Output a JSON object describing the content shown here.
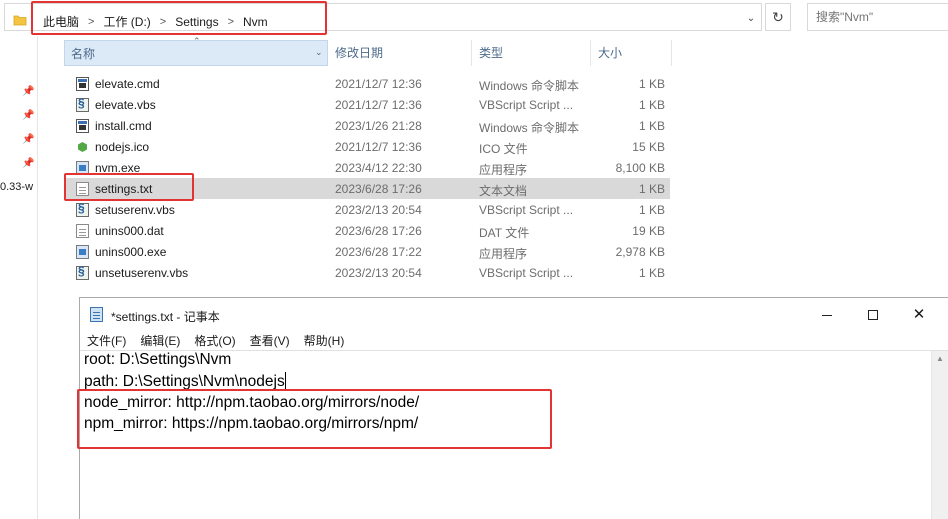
{
  "explorer": {
    "breadcrumbs": [
      "此电脑",
      "工作 (D:)",
      "Settings",
      "Nvm"
    ],
    "search_placeholder": "搜索\"Nvm\"",
    "nav_text": "0.33-w",
    "columns": {
      "name": "名称",
      "date": "修改日期",
      "type": "类型",
      "size": "大小"
    },
    "files": [
      {
        "name": "elevate.cmd",
        "date": "2021/12/7 12:36",
        "type": "Windows 命令脚本",
        "size": "1 KB",
        "icon": "cmd-file-icon"
      },
      {
        "name": "elevate.vbs",
        "date": "2021/12/7 12:36",
        "type": "VBScript Script ...",
        "size": "1 KB",
        "icon": "vbs-file-icon"
      },
      {
        "name": "install.cmd",
        "date": "2023/1/26 21:28",
        "type": "Windows 命令脚本",
        "size": "1 KB",
        "icon": "cmd-file-icon"
      },
      {
        "name": "nodejs.ico",
        "date": "2021/12/7 12:36",
        "type": "ICO 文件",
        "size": "15 KB",
        "icon": "nodejs-icon"
      },
      {
        "name": "nvm.exe",
        "date": "2023/4/12 22:30",
        "type": "应用程序",
        "size": "8,100 KB",
        "icon": "exe-file-icon"
      },
      {
        "name": "settings.txt",
        "date": "2023/6/28 17:26",
        "type": "文本文档",
        "size": "1 KB",
        "icon": "text-file-icon",
        "selected": true
      },
      {
        "name": "setuserenv.vbs",
        "date": "2023/2/13 20:54",
        "type": "VBScript Script ...",
        "size": "1 KB",
        "icon": "vbs-file-icon"
      },
      {
        "name": "unins000.dat",
        "date": "2023/6/28 17:26",
        "type": "DAT 文件",
        "size": "19 KB",
        "icon": "dat-file-icon"
      },
      {
        "name": "unins000.exe",
        "date": "2023/6/28 17:22",
        "type": "应用程序",
        "size": "2,978 KB",
        "icon": "exe-file-icon"
      },
      {
        "name": "unsetuserenv.vbs",
        "date": "2023/2/13 20:54",
        "type": "VBScript Script ...",
        "size": "1 KB",
        "icon": "vbs-file-icon"
      }
    ]
  },
  "notepad": {
    "title": "*settings.txt - 记事本",
    "menu": [
      "文件(F)",
      "编辑(E)",
      "格式(O)",
      "查看(V)",
      "帮助(H)"
    ],
    "lines": [
      "root: D:\\Settings\\Nvm",
      "path: D:\\Settings\\Nvm\\nodejs",
      "node_mirror: http://npm.taobao.org/mirrors/node/",
      "npm_mirror: https://npm.taobao.org/mirrors/npm/"
    ]
  },
  "colors": {
    "highlight_box": "#e33333",
    "selected_row": "#d9d9d9",
    "header_active": "#dceaf7"
  }
}
